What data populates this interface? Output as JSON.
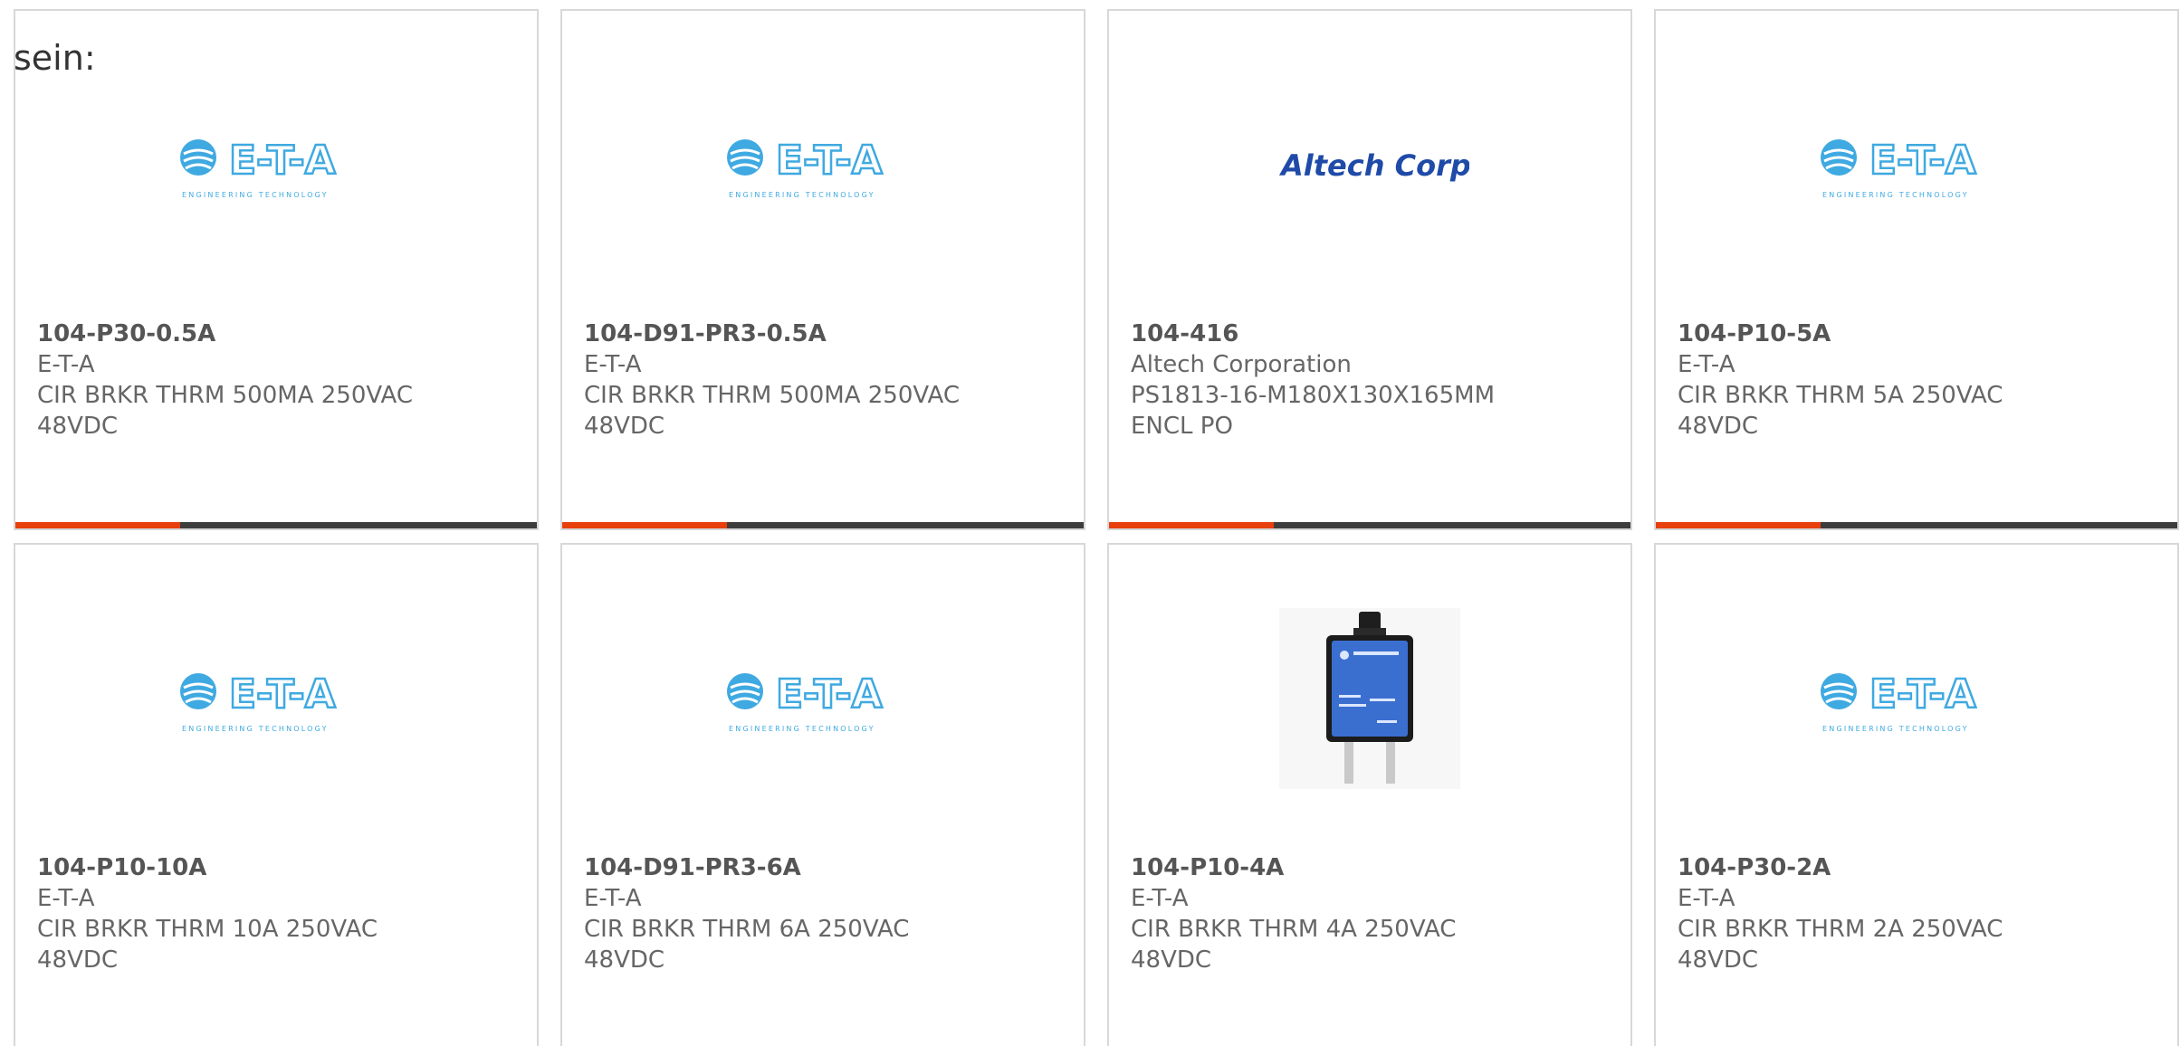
{
  "intro_text": "sein:",
  "colors": {
    "accent": "#e8400c",
    "bar": "#3d3d3d",
    "eta_blue": "#3fa9e1",
    "altech_blue": "#1f4aa8"
  },
  "products": [
    {
      "part_number": "104-P30-0.5A",
      "manufacturer": "E-T-A",
      "desc_line1": "CIR BRKR THRM 500MA 250VAC",
      "desc_line2": "48VDC",
      "image": "eta-logo",
      "logo_text": "E-T-A",
      "logo_sub": "ENGINEERING TECHNOLOGY"
    },
    {
      "part_number": "104-D91-PR3-0.5A",
      "manufacturer": "E-T-A",
      "desc_line1": "CIR BRKR THRM 500MA 250VAC",
      "desc_line2": "48VDC",
      "image": "eta-logo",
      "logo_text": "E-T-A",
      "logo_sub": "ENGINEERING TECHNOLOGY"
    },
    {
      "part_number": "104-416",
      "manufacturer": "Altech Corporation",
      "desc_line1": "PS1813-16-M180X130X165MM",
      "desc_line2": "ENCL PO",
      "image": "altech-logo",
      "logo_text": "Altech Corp."
    },
    {
      "part_number": "104-P10-5A",
      "manufacturer": "E-T-A",
      "desc_line1": "CIR BRKR THRM 5A 250VAC",
      "desc_line2": "48VDC",
      "image": "eta-logo",
      "logo_text": "E-T-A",
      "logo_sub": "ENGINEERING TECHNOLOGY"
    },
    {
      "part_number": "104-P10-10A",
      "manufacturer": "E-T-A",
      "desc_line1": "CIR BRKR THRM 10A 250VAC",
      "desc_line2": "48VDC",
      "image": "eta-logo",
      "logo_text": "E-T-A",
      "logo_sub": "ENGINEERING TECHNOLOGY"
    },
    {
      "part_number": "104-D91-PR3-6A",
      "manufacturer": "E-T-A",
      "desc_line1": "CIR BRKR THRM 6A 250VAC",
      "desc_line2": "48VDC",
      "image": "eta-logo",
      "logo_text": "E-T-A",
      "logo_sub": "ENGINEERING TECHNOLOGY"
    },
    {
      "part_number": "104-P10-4A",
      "manufacturer": "E-T-A",
      "desc_line1": "CIR BRKR THRM 4A 250VAC",
      "desc_line2": "48VDC",
      "image": "breaker-photo"
    },
    {
      "part_number": "104-P30-2A",
      "manufacturer": "E-T-A",
      "desc_line1": "CIR BRKR THRM 2A 250VAC",
      "desc_line2": "48VDC",
      "image": "eta-logo",
      "logo_text": "E-T-A",
      "logo_sub": "ENGINEERING TECHNOLOGY"
    }
  ]
}
